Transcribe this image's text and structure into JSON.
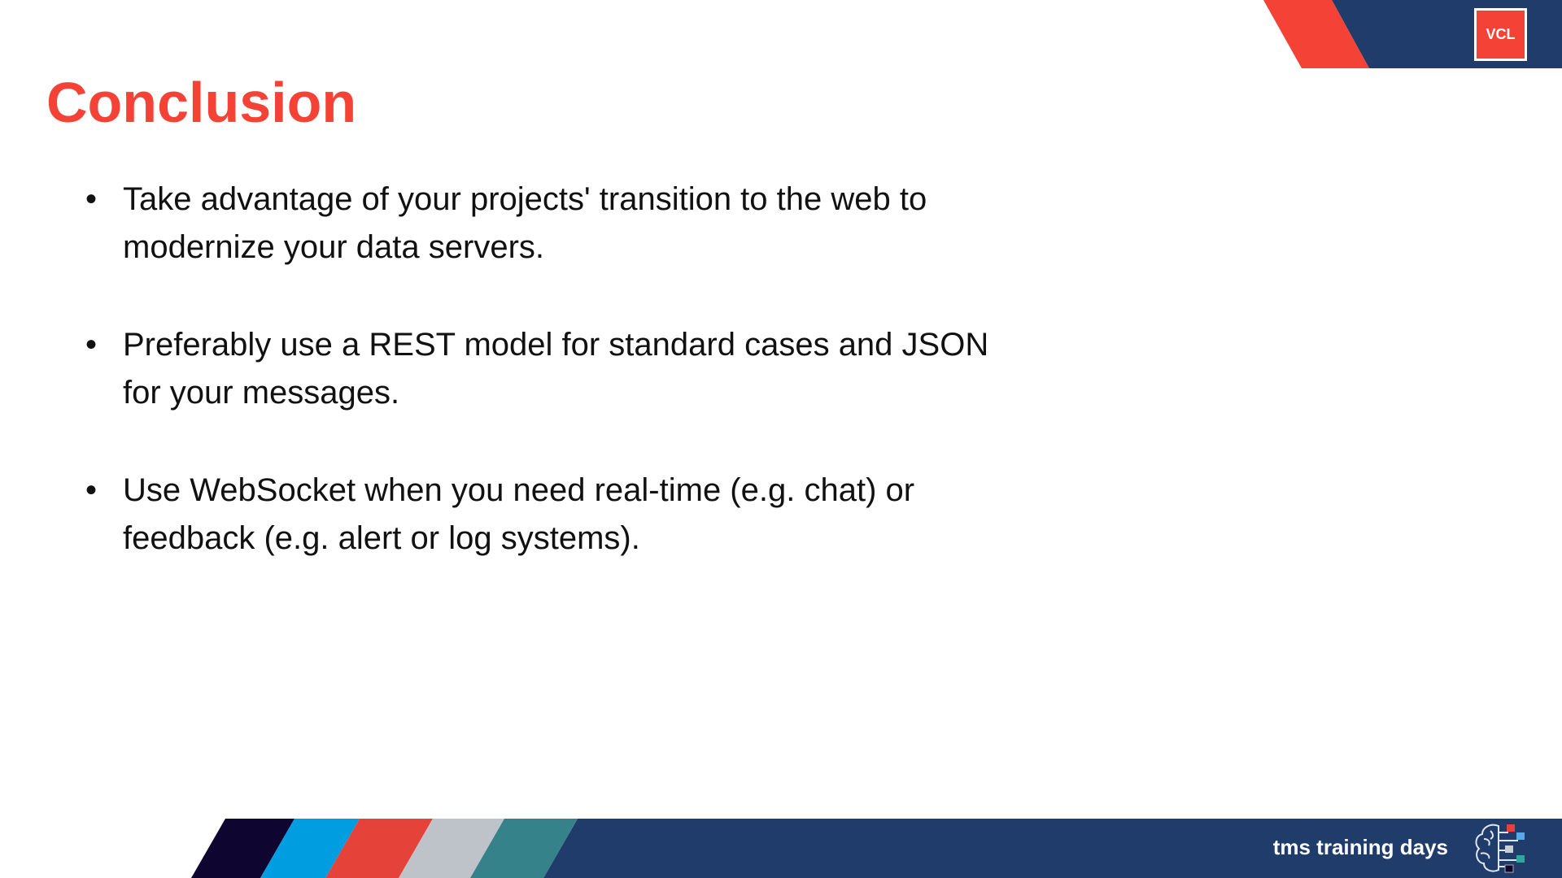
{
  "slide": {
    "title": "Conclusion",
    "bullets": [
      "Take advantage of your projects' transition to the web to modernize your data servers.",
      "Preferably use a REST model for standard cases and JSON for your messages.",
      "Use WebSocket when you need real-time (e.g. chat) or feedback (e.g. alert or log systems)."
    ],
    "bullet_glyph": "•"
  },
  "header": {
    "badge": "VCL"
  },
  "footer": {
    "brand": "tms training days",
    "icon": "brain-circuit-icon"
  },
  "colors": {
    "accent_red": "#f44336",
    "navy": "#1f3c6b",
    "stripe_dark": "#0e0630",
    "stripe_blue": "#009de0",
    "stripe_red": "#e5423a",
    "stripe_gray": "#bdc3c9",
    "stripe_teal": "#35828a"
  }
}
